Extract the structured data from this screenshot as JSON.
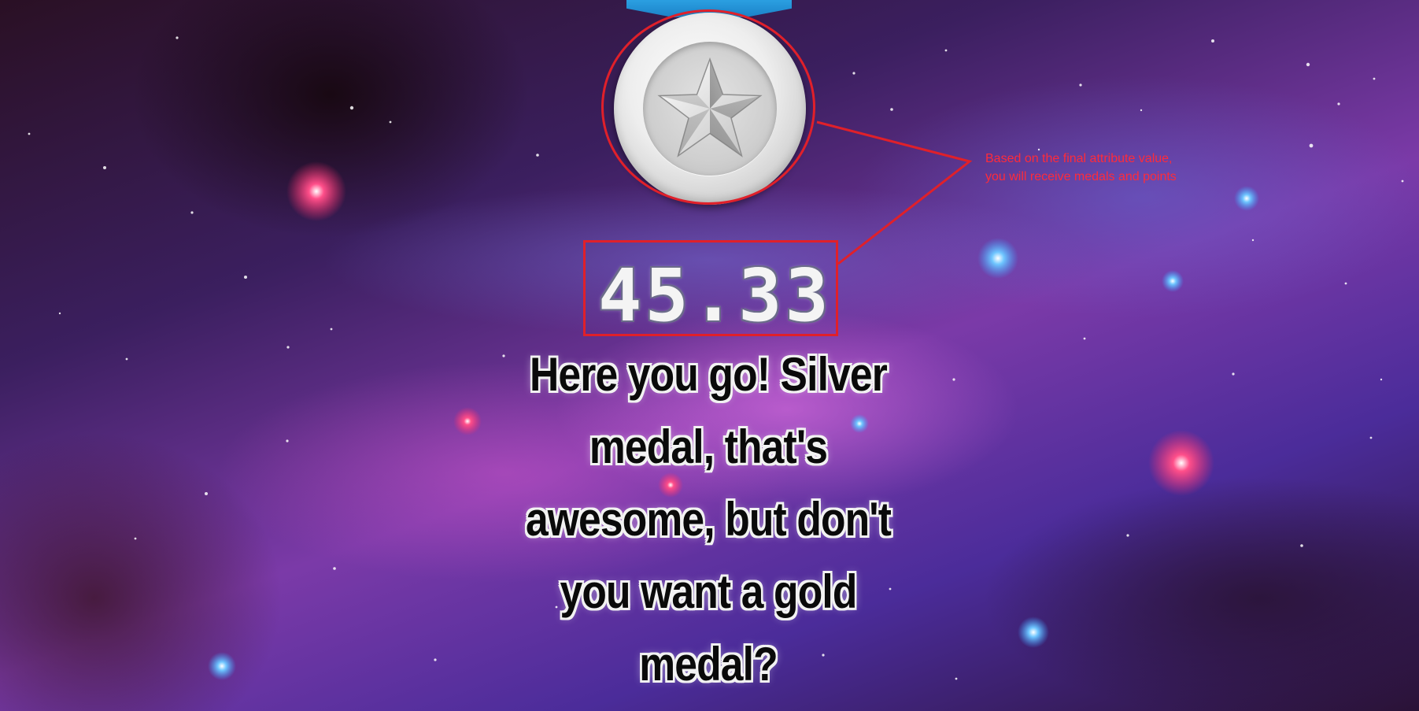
{
  "game": {
    "medal": {
      "tier": "silver",
      "icon": "star-icon",
      "ribbon_color": "#2fa7e8",
      "medal_color": "#d6d6d6"
    },
    "score": "45.33",
    "message": "Here you go! Silver medal, that's awesome, but don't you want a gold medal?"
  },
  "annotation": {
    "text_line1": "Based on the final attribute value,",
    "text_line2": "you will receive medals and points",
    "color": "#e0202a"
  }
}
